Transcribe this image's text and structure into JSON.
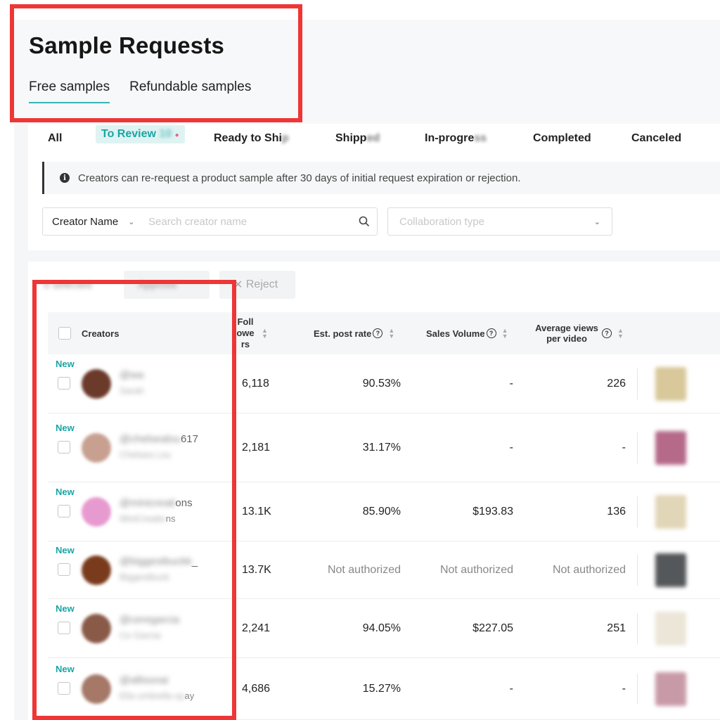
{
  "page": {
    "title": "Sample Requests",
    "tabs": [
      "Free samples",
      "Refundable samples"
    ]
  },
  "status_tabs": [
    {
      "label": "All",
      "blurred": ""
    },
    {
      "label": "To Review",
      "blurred": "10"
    },
    {
      "label": "Ready to Shi",
      "blurred": "p"
    },
    {
      "label": "Shipp",
      "blurred": "ed"
    },
    {
      "label": "In-progre",
      "blurred": "ss"
    },
    {
      "label": "Completed",
      "blurred": ""
    },
    {
      "label": "Canceled",
      "blurred": ""
    }
  ],
  "notice": "Creators can re-request a product sample after 30 days of initial request expiration or rejection.",
  "search": {
    "field_label": "Creator Name",
    "placeholder": "Search creator name",
    "collab_placeholder": "Collaboration type"
  },
  "actions": {
    "selected": "0 selected",
    "approve": "Approve",
    "reject": "Reject"
  },
  "table": {
    "headers": {
      "creators": "Creators",
      "followers": "Followers",
      "post_rate": "Est. post rate",
      "sales_volume": "Sales Volume",
      "avg_views": "Average views per video"
    },
    "rows": [
      {
        "tag": "New",
        "handle_blur": "@wa",
        "handle_visible": "",
        "sub_blur": "Sarah",
        "sub_visible": "",
        "followers": "6,118",
        "post_rate": "90.53%",
        "sales": "-",
        "views": "226",
        "avatar": "#6b3a2a",
        "thumb": "#d8c89a"
      },
      {
        "tag": "New",
        "handle_blur": "@chelsealou",
        "handle_visible": "617",
        "sub_blur": "Chelsea Lou",
        "sub_visible": "",
        "followers": "2,181",
        "post_rate": "31.17%",
        "sales": "-",
        "views": "-",
        "avatar": "#c8a090",
        "thumb": "#b56a8a"
      },
      {
        "tag": "New",
        "handle_blur": "@minicreati",
        "handle_visible": "ons",
        "sub_blur": "MiniCreatio",
        "sub_visible": "ns",
        "followers": "13.1K",
        "post_rate": "85.90%",
        "sales": "$193.83",
        "views": "136",
        "avatar": "#e79ad0",
        "thumb": "#e2d6b8"
      },
      {
        "tag": "New",
        "handle_blur": "@biggestbuckk",
        "handle_visible": "_",
        "sub_blur": "Biggestbuck",
        "sub_visible": "",
        "followers": "13.7K",
        "post_rate": "Not authorized",
        "sales": "Not authorized",
        "views": "Not authorized",
        "avatar": "#7a3b1c",
        "thumb": "#55585a"
      },
      {
        "tag": "New",
        "handle_blur": "@ceregarcia",
        "handle_visible": "",
        "sub_blur": "Ce Garcia",
        "sub_visible": "",
        "followers": "2,241",
        "post_rate": "94.05%",
        "sales": "$227.05",
        "views": "251",
        "avatar": "#8a5a48",
        "thumb": "#ece6d8"
      },
      {
        "tag": "New",
        "handle_blur": "@allisonai",
        "handle_visible": "",
        "sub_blur": "Ella umbrella ay",
        "sub_visible": "ay",
        "followers": "4,686",
        "post_rate": "15.27%",
        "sales": "-",
        "views": "-",
        "avatar": "#a57868",
        "thumb": "#c89aa8"
      }
    ]
  }
}
